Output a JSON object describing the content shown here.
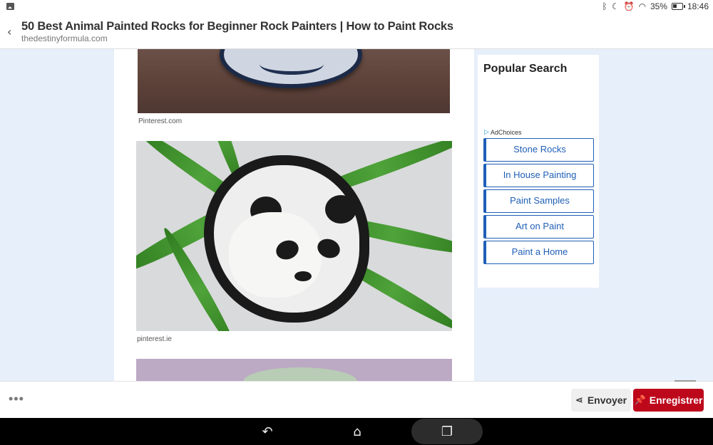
{
  "status_bar": {
    "battery_percent": "35%",
    "time": "18:46"
  },
  "header": {
    "title": "50 Best Animal Painted Rocks for Beginner Rock Painters | How to Paint Rocks",
    "domain": "thedestinyformula.com"
  },
  "article": {
    "captions": [
      "Pinterest.com",
      "pinterest.ie"
    ]
  },
  "sidebar": {
    "heading": "Popular Search",
    "adchoices": "AdChoices",
    "searches": [
      "Stone Rocks",
      "In House Painting",
      "Paint Samples",
      "Art on Paint",
      "Paint a Home"
    ]
  },
  "pin_bar": {
    "send_label": "Envoyer",
    "save_label": "Enregistrer",
    "more_glyph": "•••"
  },
  "colors": {
    "accent_blue": "#1f5fb6",
    "pinterest_red": "#bd081c",
    "page_background": "#e6effa"
  },
  "icons": [
    "image-icon",
    "bluetooth-icon",
    "moon-icon",
    "alarm-icon",
    "wifi-icon",
    "battery-icon",
    "back-chevron-icon",
    "share-icon",
    "pin-icon",
    "nav-back-icon",
    "nav-home-icon",
    "nav-recents-icon"
  ]
}
